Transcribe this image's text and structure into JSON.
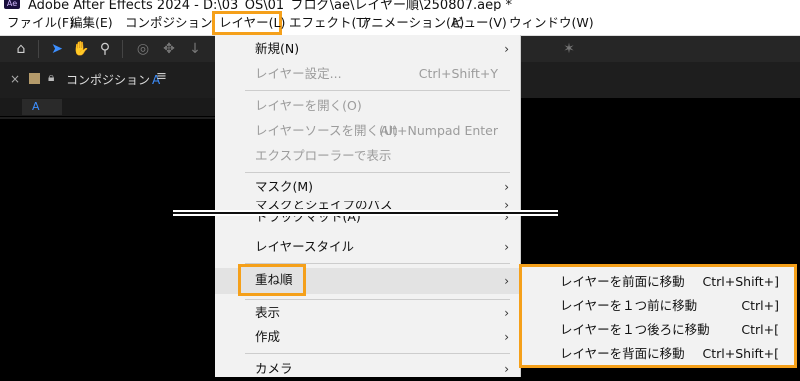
{
  "window": {
    "app_logo": "Ae",
    "title": "Adobe After Effects 2024 - D:\\03_OS\\01_ブログ\\ae\\レイヤー順\\250807.aep *"
  },
  "menubar": [
    "ファイル(F)",
    "編集(E)",
    "コンポジション(C)",
    "レイヤー(L)",
    "エフェクト(T)",
    "アニメーション(A)",
    "ビュー(V)",
    "ウィンドウ(W)"
  ],
  "toolbar": {
    "tools": [
      "home-icon",
      "selection-arrow-icon",
      "hand-icon",
      "zoom-icon",
      "orbit-icon",
      "pan-icon",
      "dolly-icon",
      "puppet-icon"
    ]
  },
  "composition_panel": {
    "close": "×",
    "tab_label": "コンポジション",
    "tab_comp_name": "A",
    "menu_glyph": "≡",
    "sub_tab": "A"
  },
  "layer_menu": {
    "items": [
      {
        "label": "新規(N)",
        "shortcut": "",
        "submenu": true,
        "disabled": false
      },
      {
        "label": "レイヤー設定...",
        "shortcut": "Ctrl+Shift+Y",
        "submenu": false,
        "disabled": true
      },
      {
        "label": "レイヤーを開く(O)",
        "shortcut": "",
        "submenu": false,
        "disabled": true
      },
      {
        "label": "レイヤーソースを開く(U)",
        "shortcut": "Alt+Numpad Enter",
        "submenu": false,
        "disabled": true
      },
      {
        "label": "エクスプローラーで表示",
        "shortcut": "",
        "submenu": false,
        "disabled": true
      },
      {
        "label": "マスク(M)",
        "shortcut": "",
        "submenu": true,
        "disabled": false
      },
      {
        "label": "マスクとシェイプのパス",
        "shortcut": "",
        "submenu": true,
        "disabled": false
      },
      {
        "label": "トラックマット(A)",
        "shortcut": "",
        "submenu": true,
        "disabled": false
      },
      {
        "label": "レイヤースタイル",
        "shortcut": "",
        "submenu": true,
        "disabled": false
      },
      {
        "label": "重ね順",
        "shortcut": "",
        "submenu": true,
        "disabled": false
      },
      {
        "label": "表示",
        "shortcut": "",
        "submenu": true,
        "disabled": false
      },
      {
        "label": "作成",
        "shortcut": "",
        "submenu": true,
        "disabled": false
      },
      {
        "label": "カメラ",
        "shortcut": "",
        "submenu": true,
        "disabled": false
      }
    ]
  },
  "arrange_submenu": {
    "items": [
      {
        "label": "レイヤーを前面に移動",
        "shortcut": "Ctrl+Shift+]"
      },
      {
        "label": "レイヤーを１つ前に移動",
        "shortcut": "Ctrl+]"
      },
      {
        "label": "レイヤーを１つ後ろに移動",
        "shortcut": "Ctrl+["
      },
      {
        "label": "レイヤーを背面に移動",
        "shortcut": "Ctrl+Shift+["
      }
    ]
  },
  "colors": {
    "highlight_box": "#f5a01a",
    "menu_bg": "#f2f2f2",
    "dark_bg": "#000000",
    "accent_blue": "#3d8fff"
  }
}
